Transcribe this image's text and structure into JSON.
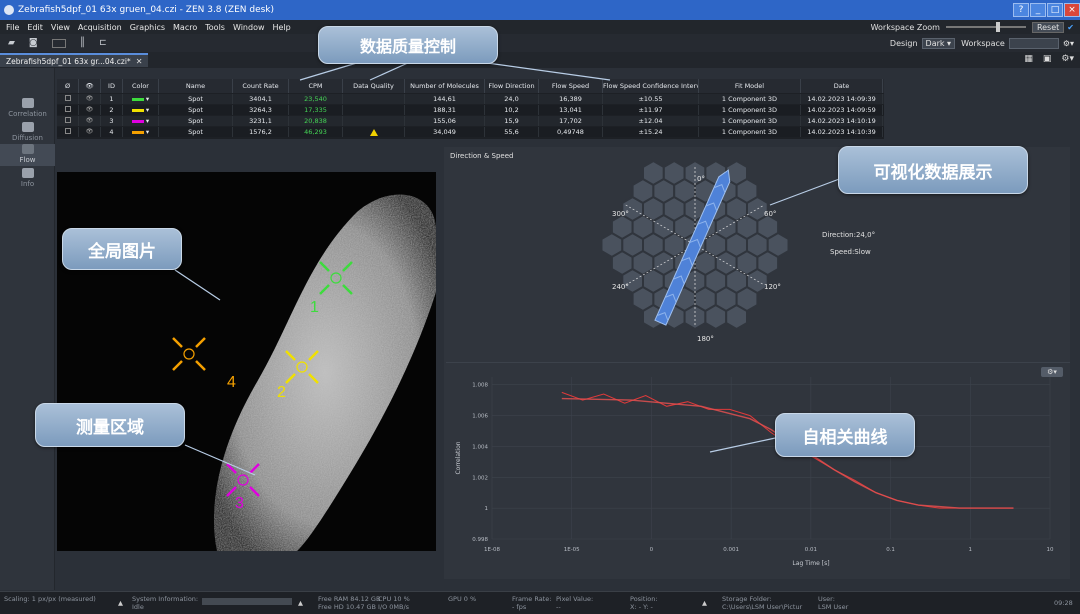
{
  "window": {
    "title": "Zebrafish5dpf_01 63x gruen_04.czi - ZEN 3.8 (ZEN desk)",
    "buttons": [
      "?",
      "_",
      "□",
      "×"
    ]
  },
  "menu": [
    "File",
    "Edit",
    "View",
    "Acquisition",
    "Graphics",
    "Macro",
    "Tools",
    "Window",
    "Help"
  ],
  "workspace_zoom": {
    "label": "Workspace Zoom",
    "reset": "Reset"
  },
  "toolbar_right": {
    "design_label": "Design",
    "design_value": "Dark",
    "workspace_label": "Workspace"
  },
  "document_tab": {
    "label": "Zebrafish5dpf_01 63x gr...04.czi*",
    "close": "✕"
  },
  "side_nav": [
    {
      "label": "Correlation",
      "selected": false
    },
    {
      "label": "Diffusion",
      "selected": false
    },
    {
      "label": "Flow",
      "selected": true
    },
    {
      "label": "Info",
      "selected": false
    }
  ],
  "table": {
    "headers": [
      "Ø",
      "👁",
      "ID",
      "Color",
      "Name",
      "Count Rate",
      "CPM",
      "Data Quality",
      "Number of Molecules",
      "Flow Direction",
      "Flow Speed",
      "Flow Speed Confidence Interval",
      "Fit Model",
      "Date"
    ],
    "rows": [
      {
        "id": "1",
        "color": "#3ddc3d",
        "name": "Spot",
        "count_rate": "3404,1",
        "cpm": "23,540",
        "quality": "",
        "molecules": "144,61",
        "direction": "24,0",
        "speed": "16,389",
        "ci": "±10.55",
        "fit": "1 Component 3D",
        "date": "14.02.2023 14:09:39"
      },
      {
        "id": "2",
        "color": "#f0e000",
        "name": "Spot",
        "count_rate": "3264,3",
        "cpm": "17,335",
        "quality": "",
        "molecules": "188,31",
        "direction": "10,2",
        "speed": "13,041",
        "ci": "±11.97",
        "fit": "1 Component 3D",
        "date": "14.02.2023 14:09:59"
      },
      {
        "id": "3",
        "color": "#e000e0",
        "name": "Spot",
        "count_rate": "3231,1",
        "cpm": "20,838",
        "quality": "",
        "molecules": "155,06",
        "direction": "15,9",
        "speed": "17,702",
        "ci": "±12.04",
        "fit": "1 Component 3D",
        "date": "14.02.2023 14:10:19"
      },
      {
        "id": "4",
        "color": "#f5a000",
        "name": "Spot",
        "count_rate": "1576,2",
        "cpm": "46,293",
        "quality": "warning",
        "molecules": "34,049",
        "direction": "55,6",
        "speed": "0,49748",
        "ci": "±15.24",
        "fit": "1 Component 3D",
        "date": "14.02.2023 14:10:39"
      }
    ]
  },
  "image_panel": {
    "spots": [
      {
        "id": "1",
        "color": "#3ddc3d"
      },
      {
        "id": "2",
        "color": "#f0e000"
      },
      {
        "id": "3",
        "color": "#e000e0"
      },
      {
        "id": "4",
        "color": "#f5a000"
      }
    ]
  },
  "direction_panel": {
    "title": "Direction & Speed",
    "angles": [
      "0°",
      "60°",
      "120°",
      "180°",
      "240°",
      "300°"
    ],
    "direction": "Direction:24,0°",
    "speed": "Speed:Slow",
    "direction_deg": 24
  },
  "chart_data": {
    "type": "line",
    "xlabel": "Lag Time [s]",
    "ylabel": "Correlation",
    "x_scale": "log",
    "x_ticks": [
      "1E-08",
      "1E-05",
      "0",
      "0.001",
      "0.01",
      "0.1",
      "1",
      "10"
    ],
    "y_ticks": [
      "0.998",
      "1",
      "1.002",
      "1.004",
      "1.006",
      "1.008"
    ],
    "ylim": [
      0.998,
      1.0085
    ],
    "series": [
      {
        "style": "measured",
        "color": "#e03a3a",
        "x": [
          1e-06,
          2e-06,
          4e-06,
          8e-06,
          1.6e-05,
          3.2e-05,
          6.4e-05,
          0.000128,
          0.000256,
          0.0005,
          0.001,
          0.002,
          0.004,
          0.008,
          0.016,
          0.032,
          0.064,
          0.13,
          0.26,
          0.5,
          1,
          2,
          3
        ],
        "y": [
          1.0075,
          1.007,
          1.0074,
          1.0068,
          1.0073,
          1.0066,
          1.0069,
          1.0064,
          1.0064,
          1.006,
          1.0049,
          1.004,
          1.0033,
          1.0025,
          1.0018,
          1.001,
          1.0005,
          1.0002,
          1.0,
          1.0,
          1.0,
          1.0,
          1.0
        ]
      },
      {
        "style": "fit",
        "color": "#e05050",
        "x": [
          1e-06,
          1e-05,
          0.0001,
          0.0005,
          0.001,
          0.002,
          0.004,
          0.008,
          0.016,
          0.032,
          0.064,
          0.13,
          0.26,
          0.5,
          1,
          3
        ],
        "y": [
          1.0071,
          1.007,
          1.0066,
          1.0058,
          1.0051,
          1.0042,
          1.0034,
          1.0025,
          1.0017,
          1.001,
          1.0005,
          1.0002,
          1.0001,
          1.0,
          1.0,
          1.0
        ]
      }
    ]
  },
  "callouts": {
    "quality": "数据质量控制",
    "visual": "可视化数据展示",
    "global": "全局图片",
    "region": "测量区域",
    "autocorr": "自相关曲线"
  },
  "status": {
    "scaling": "Scaling: 1 px/px (measured)",
    "sysinfo_label": "System Information:",
    "sysinfo_value": "Idle",
    "free_ram": "Free RAM",
    "free_ram_value": "84.12 GB",
    "free_hd": "Free HD",
    "free_hd_value": "10.47 GB",
    "cpu": "CPU 10 %",
    "io": "I/O 0MB/s",
    "gpu": "GPU 0 %",
    "frame_rate": "Frame Rate:",
    "fps": "- fps",
    "pixel_value": "Pixel Value:",
    "pixel_value_v": "--",
    "position": "Position:",
    "position_v": "X: -     Y: -",
    "storage": "Storage Folder:",
    "storage_path": "C:\\Users\\LSM User\\Pictur",
    "user": "User:",
    "user_name": "LSM User",
    "time": "09:28"
  }
}
